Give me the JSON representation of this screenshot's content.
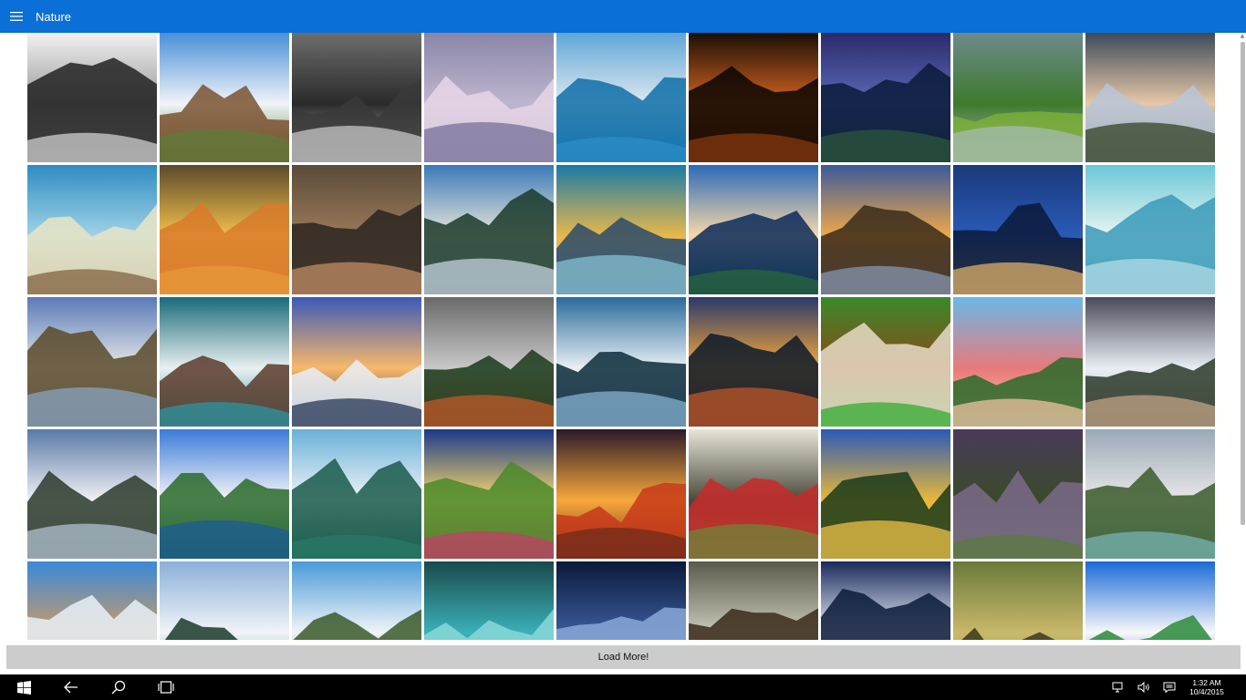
{
  "app": {
    "title": "Nature",
    "accent": "#0a6fd6",
    "menu_icon": "hamburger-icon"
  },
  "gallery": {
    "columns": 9,
    "tiles": [
      {
        "name": "snowy-mountain",
        "palette": [
          "#f2f2f2",
          "#9a9a9a",
          "#222222",
          "#d8d8d8"
        ]
      },
      {
        "name": "old-barn",
        "palette": [
          "#4a8fd8",
          "#f0f4f8",
          "#7a5230",
          "#5d7d3a"
        ]
      },
      {
        "name": "bw-ocean-storm",
        "palette": [
          "#6e6e6e",
          "#2a2a2a",
          "#3a3a3a",
          "#cfcfcf"
        ]
      },
      {
        "name": "purple-clouds",
        "palette": [
          "#8a86a8",
          "#bdb6cf",
          "#e8d6e6",
          "#6f6b93"
        ]
      },
      {
        "name": "lake-mountain-reflection",
        "palette": [
          "#5fa6d8",
          "#dfe8ef",
          "#0f6fa8",
          "#2d8fc8"
        ]
      },
      {
        "name": "dark-forest-sunset",
        "palette": [
          "#1a0f06",
          "#d4631e",
          "#0a0603",
          "#8c3a0e"
        ]
      },
      {
        "name": "purple-lake-night",
        "palette": [
          "#2b2a6a",
          "#5a6ab8",
          "#0a1a3a",
          "#2d5a3a"
        ]
      },
      {
        "name": "green-valley",
        "palette": [
          "#6d8a8c",
          "#3e7a2c",
          "#7bae3a",
          "#a8bcb8"
        ]
      },
      {
        "name": "sea-of-clouds",
        "palette": [
          "#3d4a5a",
          "#e7c8a8",
          "#b8c6d8",
          "#2a3a1a"
        ]
      },
      {
        "name": "blue-horizon",
        "palette": [
          "#2f8cc2",
          "#9fd3e6",
          "#e8e4c6",
          "#7a5a3a"
        ]
      },
      {
        "name": "golden-beach-sunset",
        "palette": [
          "#5b4a2a",
          "#f4c04a",
          "#d87a2a",
          "#e89a3a"
        ]
      },
      {
        "name": "foggy-peak",
        "palette": [
          "#5a4a3a",
          "#9a7a5a",
          "#2a2520",
          "#c9926a"
        ]
      },
      {
        "name": "snowy-trees-mountain",
        "palette": [
          "#3a7ab8",
          "#e8e6d8",
          "#1a3a2a",
          "#cfdce8"
        ]
      },
      {
        "name": "ocean-wave-curl",
        "palette": [
          "#1a7aa8",
          "#e8b84a",
          "#2a4a6a",
          "#8ac8d8"
        ]
      },
      {
        "name": "island-reflection",
        "palette": [
          "#2a6ab8",
          "#f8d8a8",
          "#0a2a5a",
          "#2a6a3a"
        ]
      },
      {
        "name": "sunset-rocks",
        "palette": [
          "#3a5a9a",
          "#f0a84a",
          "#3a2a1a",
          "#8a9ab8"
        ]
      },
      {
        "name": "stormy-blue-sky",
        "palette": [
          "#1a3a7a",
          "#2a5ab8",
          "#0a1a3a",
          "#e8b86a"
        ]
      },
      {
        "name": "frozen-wave",
        "palette": [
          "#6ac8d8",
          "#e8f4f0",
          "#3a9ab8",
          "#b8e0e8"
        ]
      },
      {
        "name": "mountain-stream",
        "palette": [
          "#5a7ab8",
          "#e8e8e8",
          "#5a4a2a",
          "#8aa8c8"
        ]
      },
      {
        "name": "crashing-waves-rocks",
        "palette": [
          "#1a6a7a",
          "#e8f0f0",
          "#5a3a2a",
          "#2a9aa8"
        ]
      },
      {
        "name": "snowy-pines-sunset",
        "palette": [
          "#3a5ab8",
          "#f8b86a",
          "#e8eef8",
          "#1a2a4a"
        ]
      },
      {
        "name": "misty-pine-forest",
        "palette": [
          "#6a6a6a",
          "#c8c8c8",
          "#1a3a1a",
          "#c85a2a"
        ]
      },
      {
        "name": "frozen-lake-trees",
        "palette": [
          "#2a6a9a",
          "#e8f0f4",
          "#0a2a3a",
          "#8ab8d8"
        ]
      },
      {
        "name": "sunset-wave-eye",
        "palette": [
          "#2a3a6a",
          "#f8a83a",
          "#0a1a2a",
          "#c85a2a"
        ]
      },
      {
        "name": "mushroom-leaf",
        "palette": [
          "#3a8a2a",
          "#8a4a1a",
          "#e8dcc8",
          "#2aa82a"
        ]
      },
      {
        "name": "pink-mountains-valley",
        "palette": [
          "#6ab8e8",
          "#e87a7a",
          "#2a6a2a",
          "#f8c8a8"
        ]
      },
      {
        "name": "waterfall-cliffs",
        "palette": [
          "#4a4a5a",
          "#e8eef4",
          "#2a3a2a",
          "#c8a88a"
        ]
      },
      {
        "name": "snowy-village-mountains",
        "palette": [
          "#5a7aa8",
          "#f0f0f4",
          "#2a3a2a",
          "#b8c8d8"
        ]
      },
      {
        "name": "river-blue-sky",
        "palette": [
          "#3a7ad8",
          "#f8f8f8",
          "#2a6a2a",
          "#1a5a9a"
        ]
      },
      {
        "name": "sea-cliffs-island",
        "palette": [
          "#6ab0d8",
          "#f0f4f8",
          "#1a5a4a",
          "#2a7a6a"
        ]
      },
      {
        "name": "sunburst-meadow",
        "palette": [
          "#1a3a8a",
          "#f8d86a",
          "#4a8a2a",
          "#c83a6a"
        ]
      },
      {
        "name": "fiery-sky-sunset",
        "palette": [
          "#2a1a2a",
          "#f8a83a",
          "#c83a1a",
          "#6a2a1a"
        ]
      },
      {
        "name": "birch-forest-red",
        "palette": [
          "#e8e4d8",
          "#4a4a3a",
          "#c82a2a",
          "#6a8a3a"
        ]
      },
      {
        "name": "autumn-lake-trees",
        "palette": [
          "#2a5ab8",
          "#e8b83a",
          "#1a3a1a",
          "#f8c84a"
        ]
      },
      {
        "name": "mountain-flowers",
        "palette": [
          "#4a3a5a",
          "#3a4a2a",
          "#7a6a8a",
          "#5a7a3a"
        ]
      },
      {
        "name": "fjord-valley",
        "palette": [
          "#9aa8b8",
          "#e8e8e8",
          "#3a5a2a",
          "#7ab8b8"
        ]
      },
      {
        "name": "rock-in-surf",
        "palette": [
          "#3a8ad8",
          "#c89a6a",
          "#e8f0f8",
          "#2a7aa8"
        ]
      },
      {
        "name": "river-rapids-forest",
        "palette": [
          "#8ab0d8",
          "#f0f4f8",
          "#1a3a2a",
          "#6a8a9a"
        ]
      },
      {
        "name": "waterfall-gorge",
        "palette": [
          "#4a9ad8",
          "#f0f4f8",
          "#3a5a2a",
          "#8a7a5a"
        ]
      },
      {
        "name": "spruce-branch",
        "palette": [
          "#1a4a4a",
          "#3ab0b8",
          "#8ad8d8",
          "#2a7a7a"
        ]
      },
      {
        "name": "milky-way",
        "palette": [
          "#0a1a3a",
          "#3a5a9a",
          "#8aa8d8",
          "#1a2a5a"
        ]
      },
      {
        "name": "misty-redwoods",
        "palette": [
          "#5a5a4a",
          "#c8c8b8",
          "#3a2a1a",
          "#7a8a6a"
        ]
      },
      {
        "name": "snowy-forest-night",
        "palette": [
          "#1a2a5a",
          "#e8eef8",
          "#0a1a3a",
          "#5a7ab8"
        ]
      },
      {
        "name": "forest-cottage",
        "palette": [
          "#6a7a3a",
          "#c8b86a",
          "#3a3a1a",
          "#8aa84a"
        ]
      },
      {
        "name": "tropical-island",
        "palette": [
          "#1a6ad8",
          "#f8f8f8",
          "#2a8a3a",
          "#0a4aa8"
        ]
      }
    ]
  },
  "load_more": {
    "label": "Load More!"
  },
  "taskbar": {
    "start_icon": "windows-start-icon",
    "back_icon": "back-arrow-icon",
    "search_icon": "search-icon",
    "task_view_icon": "task-view-icon",
    "network_icon": "network-icon",
    "volume_icon": "volume-icon",
    "notifications_icon": "action-center-icon",
    "time": "1:32 AM",
    "date": "10/4/2015"
  }
}
